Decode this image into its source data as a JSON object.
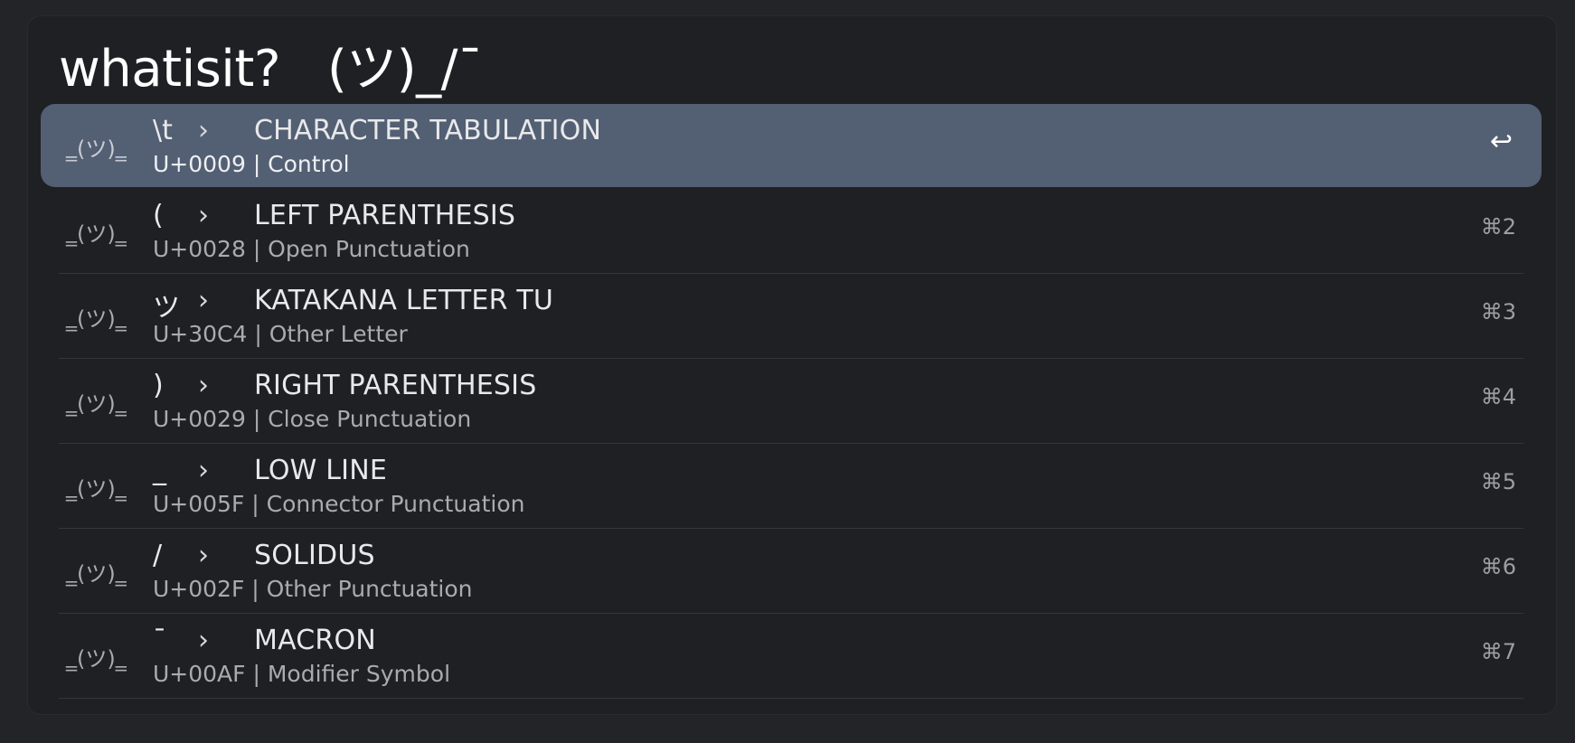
{
  "search": {
    "value": "whatisit?   (ツ)_/¯"
  },
  "results": [
    {
      "icon": "‗(ツ)‗",
      "char": "\\t",
      "arrow": "›",
      "name": "CHARACTER TABULATION",
      "subtitle": "U+0009 | Control",
      "shortcut": "↩",
      "selected": true
    },
    {
      "icon": "‗(ツ)‗",
      "char": "(",
      "arrow": "›",
      "name": "LEFT PARENTHESIS",
      "subtitle": "U+0028 | Open Punctuation",
      "shortcut": "⌘2",
      "selected": false
    },
    {
      "icon": "‗(ツ)‗",
      "char": "ツ",
      "arrow": "›",
      "name": "KATAKANA LETTER TU",
      "subtitle": "U+30C4 | Other Letter",
      "shortcut": "⌘3",
      "selected": false
    },
    {
      "icon": "‗(ツ)‗",
      "char": ")",
      "arrow": "›",
      "name": "RIGHT PARENTHESIS",
      "subtitle": "U+0029 | Close Punctuation",
      "shortcut": "⌘4",
      "selected": false
    },
    {
      "icon": "‗(ツ)‗",
      "char": "_",
      "arrow": "›",
      "name": "LOW LINE",
      "subtitle": "U+005F | Connector Punctuation",
      "shortcut": "⌘5",
      "selected": false
    },
    {
      "icon": "‗(ツ)‗",
      "char": "/",
      "arrow": "›",
      "name": "SOLIDUS",
      "subtitle": "U+002F | Other Punctuation",
      "shortcut": "⌘6",
      "selected": false
    },
    {
      "icon": "‗(ツ)‗",
      "char": "¯",
      "arrow": "›",
      "name": "MACRON",
      "subtitle": "U+00AF | Modifier Symbol",
      "shortcut": "⌘7",
      "selected": false
    }
  ],
  "colors": {
    "background": "#232427",
    "window": "#1f2024",
    "selected_row": "#535f73",
    "divider": "#35363a",
    "primary_text": "#e8e9eb",
    "secondary_text": "#a9abb0"
  }
}
